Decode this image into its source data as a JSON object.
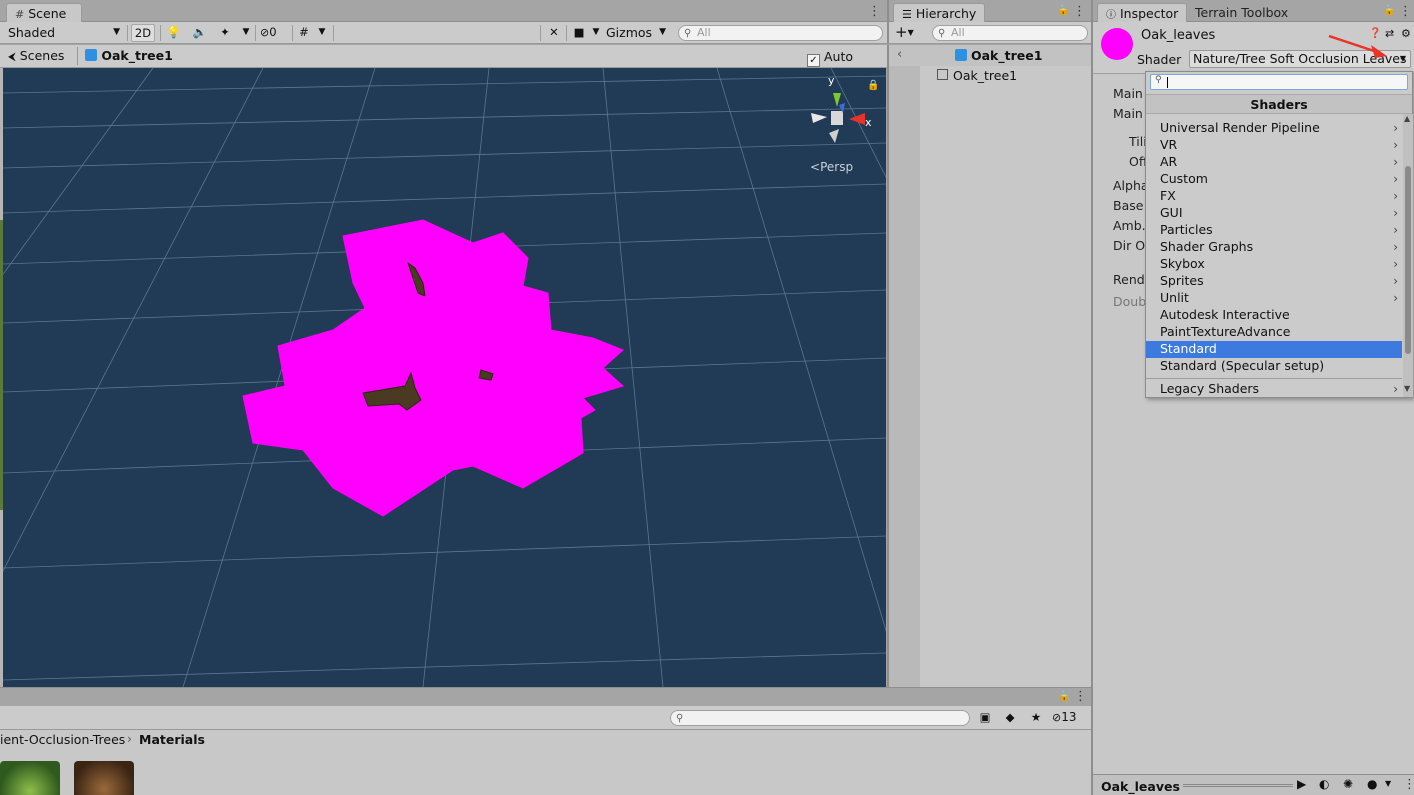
{
  "scene": {
    "tab_label": "Scene",
    "shading_mode": "Shaded",
    "btn_2d": "2D",
    "hidden_count": "0",
    "gizmos_label": "Gizmos",
    "search_placeholder": "All",
    "breadcrumb_root": "Scenes",
    "breadcrumb_current": "Oak_tree1",
    "auto_save_label": "Auto Save",
    "auto_save_checked": "✓",
    "axis_y": "y",
    "axis_x": "x",
    "persp_label": "Persp"
  },
  "hierarchy": {
    "tab_label": "Hierarchy",
    "search_placeholder": "All",
    "add_label": "+",
    "root_item": "Oak_tree1",
    "child_item": "Oak_tree1"
  },
  "inspector": {
    "tab_label": "Inspector",
    "tab2_label": "Terrain Toolbox",
    "material_name": "Oak_leaves",
    "shader_label": "Shader",
    "shader_value": "Nature/Tree Soft Occlusion Leaves",
    "props_partial": [
      "Main (",
      "Main T",
      "Tili",
      "Off",
      "Alpha",
      "Base I",
      "Amb. (",
      "Dir Oc",
      "Rende",
      "Doubl"
    ],
    "bottom_name": "Oak_leaves"
  },
  "shader_menu": {
    "header": "Shaders",
    "items": [
      {
        "label": "Universal Render Pipeline",
        "sub": "›"
      },
      {
        "label": "VR",
        "sub": "›"
      },
      {
        "label": "AR",
        "sub": "›"
      },
      {
        "label": "Custom",
        "sub": "›"
      },
      {
        "label": "FX",
        "sub": "›"
      },
      {
        "label": "GUI",
        "sub": "›"
      },
      {
        "label": "Particles",
        "sub": "›"
      },
      {
        "label": "Shader Graphs",
        "sub": "›"
      },
      {
        "label": "Skybox",
        "sub": "›"
      },
      {
        "label": "Sprites",
        "sub": "›"
      },
      {
        "label": "Unlit",
        "sub": "›"
      },
      {
        "label": "Autodesk Interactive",
        "sub": ""
      },
      {
        "label": "PaintTextureAdvance",
        "sub": ""
      },
      {
        "label": "Standard",
        "sub": ""
      },
      {
        "label": "Standard (Specular setup)",
        "sub": ""
      }
    ],
    "selected_index": 13,
    "footer": {
      "label": "Legacy Shaders",
      "sub": "›"
    }
  },
  "project": {
    "breadcrumb_parent": "ient-Occlusion-Trees",
    "breadcrumb_sep": "›",
    "breadcrumb_current": "Materials",
    "hidden_count": "13"
  },
  "colors": {
    "scene_bg": "#213a55",
    "leaves": "#ff00ff",
    "selection": "#3d7ae0",
    "arrow": "#e8322a"
  }
}
